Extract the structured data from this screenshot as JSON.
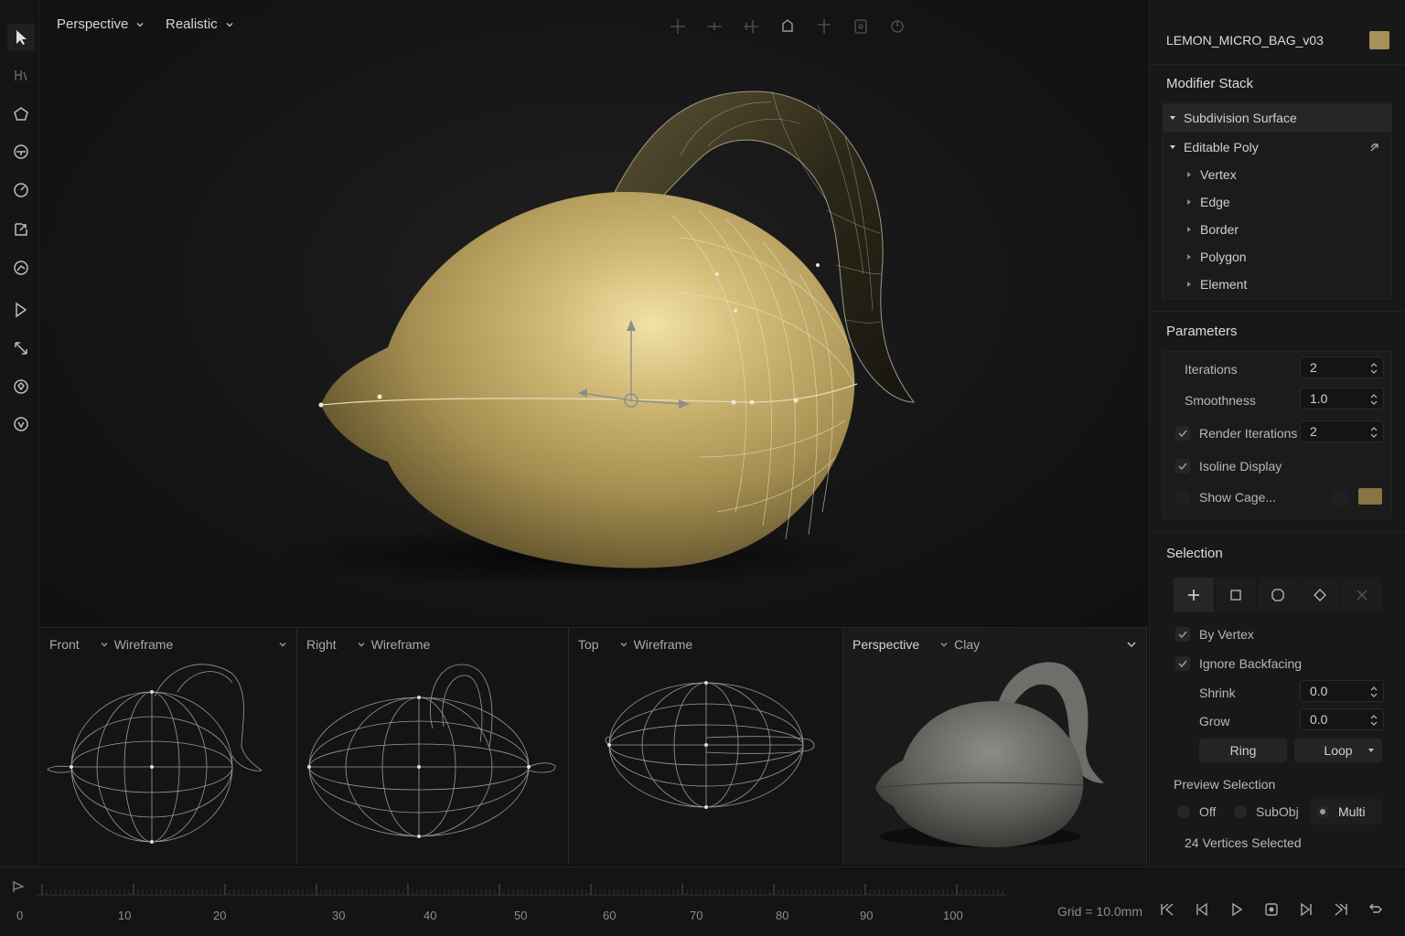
{
  "viewport": {
    "view_label": "Perspective",
    "shading_label": "Realistic"
  },
  "subviews": [
    {
      "view": "Front",
      "mode": "Wireframe"
    },
    {
      "view": "Right",
      "mode": "Wireframe"
    },
    {
      "view": "Top",
      "mode": "Wireframe"
    },
    {
      "view": "Perspective",
      "mode": "Clay"
    }
  ],
  "panel": {
    "object_name": "LEMON_MICRO_BAG_v03",
    "object_color": "#a8905a",
    "modifier_stack_title": "Modifier Stack",
    "stack": [
      {
        "label": "Subdivision Surface",
        "level": 0,
        "expanded": true,
        "selected": true
      },
      {
        "label": "Editable Poly",
        "level": 0,
        "expanded": true,
        "selected": false
      },
      {
        "label": "Vertex",
        "level": 1
      },
      {
        "label": "Edge",
        "level": 1
      },
      {
        "label": "Border",
        "level": 1
      },
      {
        "label": "Polygon",
        "level": 1
      },
      {
        "label": "Element",
        "level": 1
      }
    ],
    "parameters_title": "Parameters",
    "iterations_label": "Iterations",
    "iterations_value": "2",
    "smoothness_label": "Smoothness",
    "smoothness_value": "1.0",
    "render_iterations_label": "Render Iterations",
    "render_iterations_value": "2",
    "isoline_label": "Isoline Display",
    "show_cage_label": "Show Cage...",
    "cage_color": "#8a7445",
    "selection_title": "Selection",
    "by_vertex_label": "By Vertex",
    "ignore_backfacing_label": "Ignore Backfacing",
    "shrink_label": "Shrink",
    "shrink_value": "0.0",
    "grow_label": "Grow",
    "grow_value": "0.0",
    "ring_label": "Ring",
    "loop_label": "Loop",
    "preview_selection_label": "Preview Selection",
    "preview_off": "Off",
    "preview_subobj": "SubObj",
    "preview_multi": "Multi",
    "status": "24 Vertices Selected"
  },
  "timeline": {
    "ticks": [
      "0",
      "10",
      "20",
      "30",
      "40",
      "50",
      "60",
      "70",
      "80",
      "90",
      "100"
    ],
    "grid_readout": "Grid = 10.0mm"
  }
}
